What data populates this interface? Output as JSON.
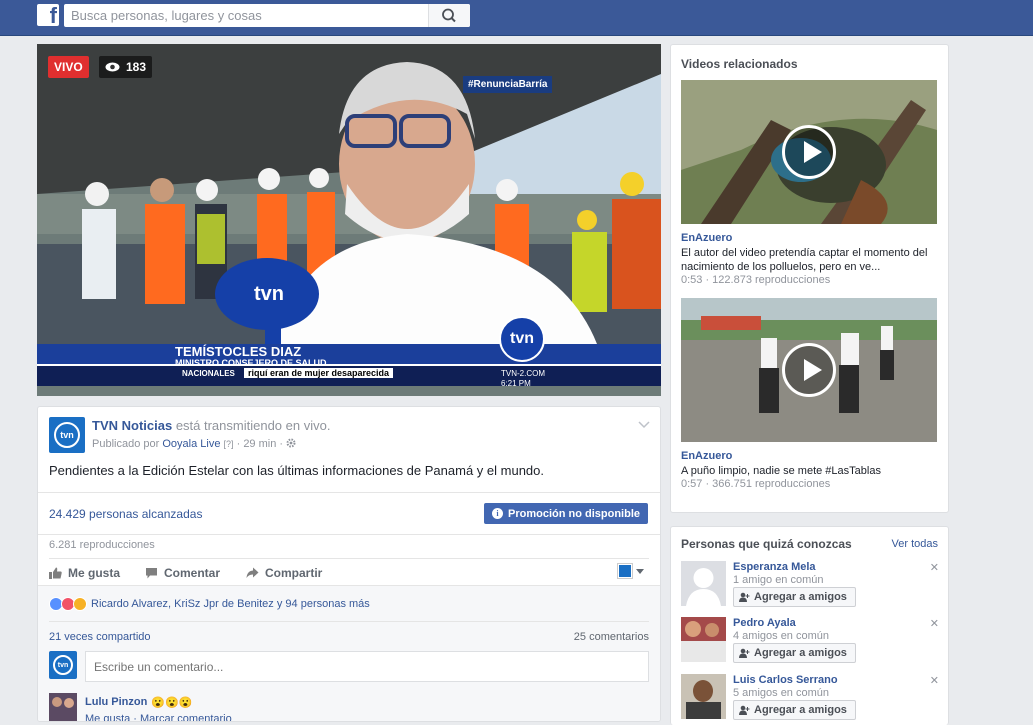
{
  "topbar": {
    "logo": "f",
    "search_placeholder": "Busca personas, lugares y cosas"
  },
  "video": {
    "live_badge": "VIVO",
    "viewer_count": "183",
    "hashtag": "#RenunciaBarría",
    "name": "TEMÍSTOCLES DIAZ",
    "role": "MINISTRO CONSEJERO DE SALUD",
    "section": "NACIONALES",
    "ticker": "riquí eran de mujer desaparecida",
    "site": "TVN-2.COM",
    "time": "6:21 PM",
    "channel_logo": "tvn"
  },
  "post": {
    "page_name": "TVN Noticias",
    "live_text": "está transmitiendo en vivo.",
    "published_by_prefix": "Publicado por",
    "published_by": "Ooyala Live",
    "help_mark": "[?]",
    "time_ago": "29 min",
    "body": "Pendientes a la Edición Estelar con las últimas informaciones de Panamá y el mundo.",
    "reach": "24.429 personas alcanzadas",
    "promo_button": "Promoción no disponible",
    "plays": "6.281 reproducciones",
    "actions": {
      "like": "Me gusta",
      "comment": "Comentar",
      "share": "Compartir"
    },
    "reactions_text": "Ricardo Alvarez, KriSz Jpr de Benitez y 94 personas más",
    "shares": "21 veces compartido",
    "comments_count": "25 comentarios",
    "comment_placeholder": "Escribe un comentario...",
    "first_comment_author": "Lulu Pinzon",
    "first_comment_emojis": "😮😮😮",
    "first_comment_actions": "Me gusta · Marcar comentario"
  },
  "related": {
    "title": "Videos relacionados",
    "videos": [
      {
        "source": "EnAzuero",
        "description": "El autor del video pretendía captar el momento del nacimiento de los polluelos, pero en ve...",
        "meta": "0:53 · 122.873 reproducciones"
      },
      {
        "source": "EnAzuero",
        "description": "A puño limpio, nadie se mete #LasTablas",
        "meta": "0:57 · 366.751 reproducciones"
      }
    ]
  },
  "pymk": {
    "title": "Personas que quizá conozcas",
    "see_all": "Ver todas",
    "add_label": "Agregar a amigos",
    "people": [
      {
        "name": "Esperanza Mela",
        "mutual": "1 amigo en común"
      },
      {
        "name": "Pedro Ayala",
        "mutual": "4 amigos en común"
      },
      {
        "name": "Luis Carlos Serrano",
        "mutual": "5 amigos en común"
      }
    ]
  },
  "colors": {
    "brand": "#3b5998",
    "link": "#365899",
    "live": "#e02f2f",
    "promo": "#4267b2"
  }
}
